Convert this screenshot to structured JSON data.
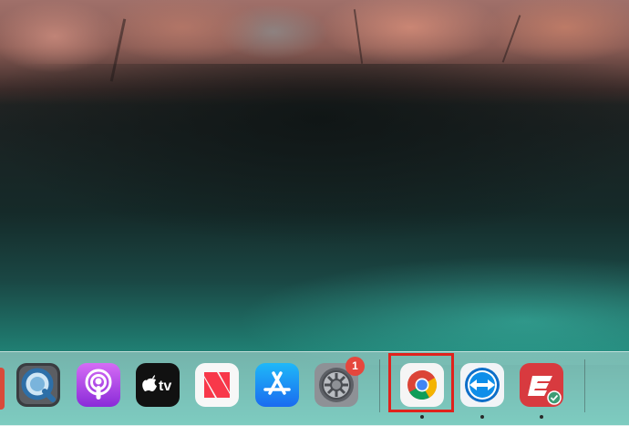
{
  "wallpaper": {
    "description_colors": [
      "#a0706a",
      "#152a29",
      "#30b3a0"
    ]
  },
  "dock": {
    "apps": [
      {
        "id": "quicktime",
        "icon": "quicktime-icon"
      },
      {
        "id": "podcasts",
        "icon": "podcasts-icon"
      },
      {
        "id": "apple-tv",
        "icon": "apple-tv-icon",
        "label": "tv"
      },
      {
        "id": "news",
        "icon": "news-icon"
      },
      {
        "id": "app-store",
        "icon": "app-store-icon"
      },
      {
        "id": "system-preferences",
        "icon": "gear-icon",
        "badge": "1"
      },
      {
        "id": "chrome",
        "icon": "chrome-icon",
        "highlighted": true,
        "running": true
      },
      {
        "id": "teamviewer",
        "icon": "teamviewer-icon",
        "running": true
      },
      {
        "id": "expressvpn",
        "icon": "expressvpn-icon",
        "running": true
      }
    ]
  },
  "colors": {
    "highlight": "#e0221c",
    "badge": "#e5473d"
  }
}
